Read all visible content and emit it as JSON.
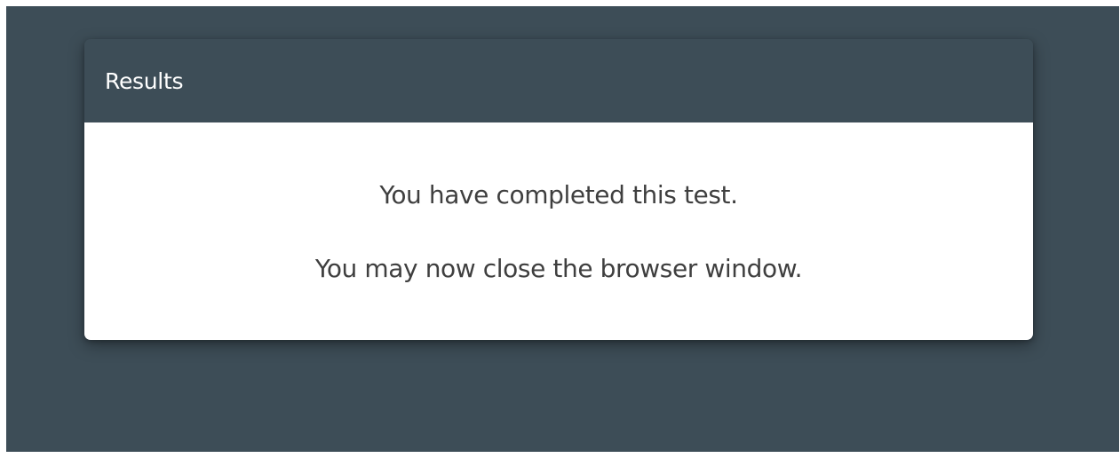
{
  "colors": {
    "page_background": "#3d4d57",
    "header_background": "#3d4d57",
    "card_background": "#ffffff",
    "title_text": "#ffffff",
    "body_text": "#3f3f3f"
  },
  "results_card": {
    "title": "Results",
    "messages": [
      "You have completed this test.",
      "You may now close the browser window."
    ]
  }
}
